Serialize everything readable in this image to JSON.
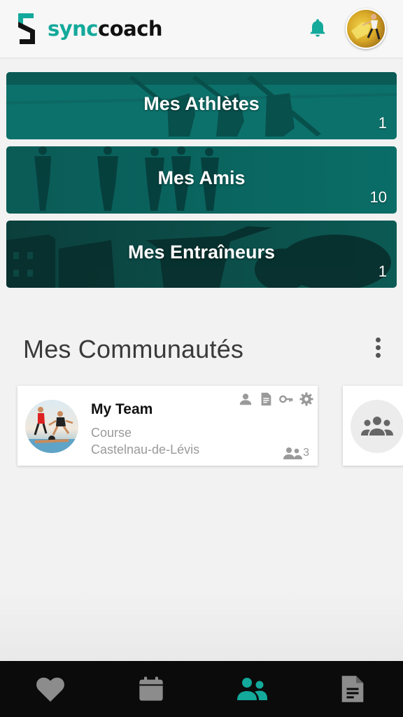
{
  "header": {
    "brand_prefix": "sync",
    "brand_suffix": "coach",
    "icons": {
      "logo": "syncoach-s-logo",
      "notifications": "bell-icon",
      "profile": "user-avatar"
    }
  },
  "categories": [
    {
      "title": "Mes Athlètes",
      "count": "1"
    },
    {
      "title": "Mes Amis",
      "count": "10"
    },
    {
      "title": "Mes Entraîneurs",
      "count": "1"
    }
  ],
  "communities": {
    "title": "Mes Communautés",
    "cards": [
      {
        "name": "My Team",
        "sport": "Course",
        "city": "Castelnau-de-Lévis",
        "member_count": "3",
        "action_icons": [
          "person-icon",
          "document-icon",
          "key-icon",
          "gear-icon"
        ]
      }
    ],
    "placeholder_icon": "group-icon"
  },
  "bottom_nav": {
    "tabs": [
      {
        "icon": "heart-icon",
        "active": false
      },
      {
        "icon": "calendar-icon",
        "active": false
      },
      {
        "icon": "group-icon",
        "active": true
      },
      {
        "icon": "document-icon",
        "active": false
      }
    ]
  },
  "colors": {
    "accent": "#13a99b",
    "banner_tint": "#0c6f68",
    "nav_background": "#0b0b0b",
    "nav_icon": "#8c8c8c",
    "muted_text": "#9a9a9a"
  }
}
